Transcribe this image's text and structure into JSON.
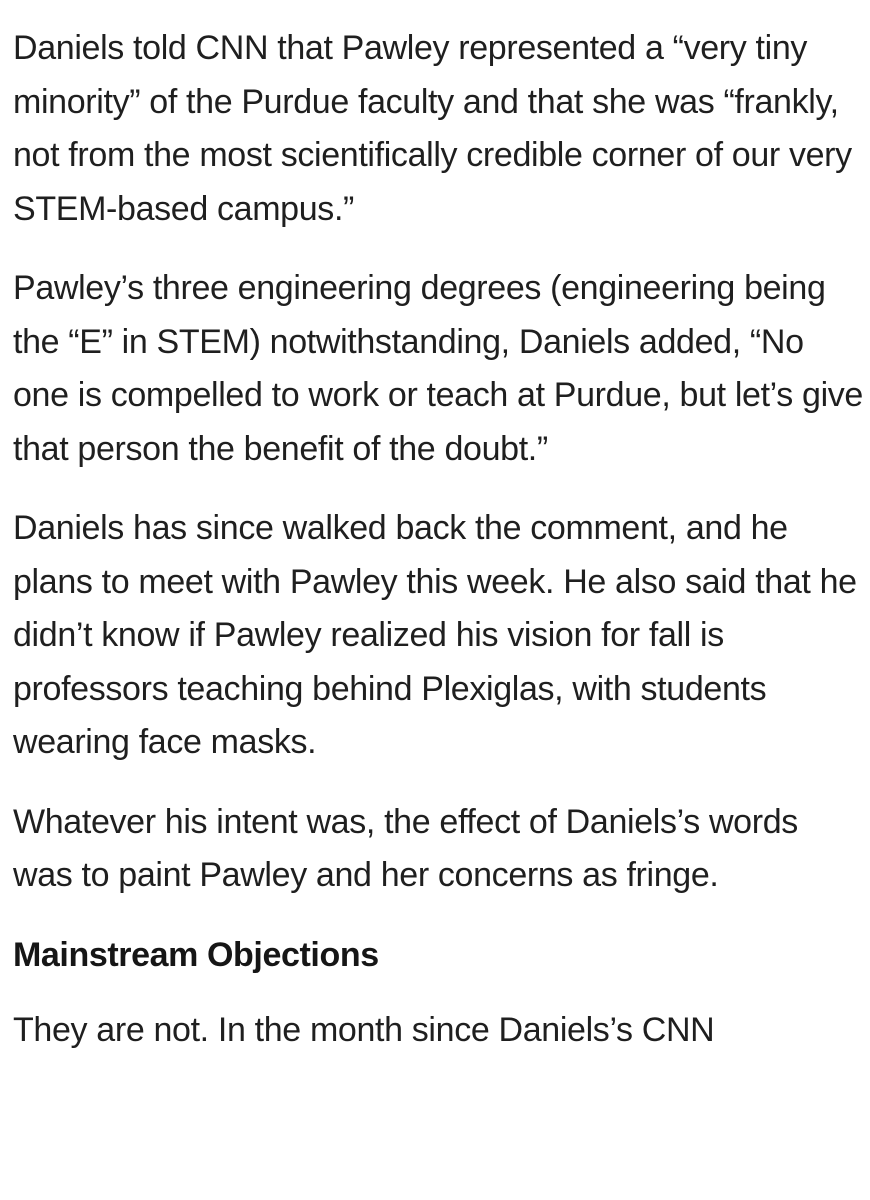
{
  "article": {
    "paragraphs": [
      "Daniels told CNN that Pawley represented a “very tiny minority” of the Purdue faculty and that she was “frankly, not from the most scientifically credible corner of our very STEM-based campus.”",
      "Pawley’s three engineering degrees (engineering being the “E” in STEM) notwithstanding, Daniels added, “No one is compelled to work or teach at Purdue, but let’s give that person the benefit of the doubt.”",
      "Daniels has since walked back the comment, and he plans to meet with Pawley this week. He also said that he didn’t know if Pawley realized his vision for fall is professors teaching behind Plexiglas, with students wearing face masks.",
      "Whatever his intent was, the effect of Daniels’s words was to paint Pawley and her concerns as fringe."
    ],
    "section_heading": "Mainstream Objections",
    "trailing_paragraph": "They are not. In the month since Daniels’s CNN"
  }
}
